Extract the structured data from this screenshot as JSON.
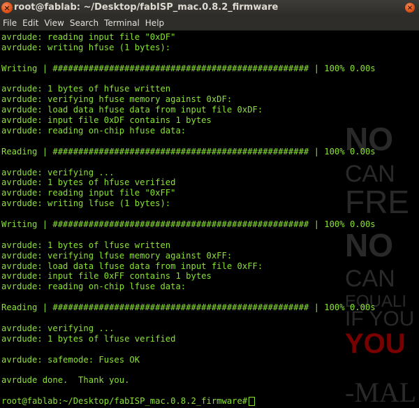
{
  "window": {
    "title": "root@fablab: ~/Desktop/fabISP_mac.0.8.2_firmware",
    "close_glyph": "×"
  },
  "menu": [
    "File",
    "Edit",
    "View",
    "Search",
    "Terminal",
    "Help"
  ],
  "terminal": {
    "text_color": "#8ae234",
    "lines": [
      "avrdude: reading input file \"0xDF\"",
      "avrdude: writing hfuse (1 bytes):",
      "",
      "Writing | ################################################## | 100% 0.00s",
      "",
      "avrdude: 1 bytes of hfuse written",
      "avrdude: verifying hfuse memory against 0xDF:",
      "avrdude: load data hfuse data from input file 0xDF:",
      "avrdude: input file 0xDF contains 1 bytes",
      "avrdude: reading on-chip hfuse data:",
      "",
      "Reading | ################################################## | 100% 0.00s",
      "",
      "avrdude: verifying ...",
      "avrdude: 1 bytes of hfuse verified",
      "avrdude: reading input file \"0xFF\"",
      "avrdude: writing lfuse (1 bytes):",
      "",
      "Writing | ################################################## | 100% 0.00s",
      "",
      "avrdude: 1 bytes of lfuse written",
      "avrdude: verifying lfuse memory against 0xFF:",
      "avrdude: load data lfuse data from input file 0xFF:",
      "avrdude: input file 0xFF contains 1 bytes",
      "avrdude: reading on-chip lfuse data:",
      "",
      "Reading | ################################################## | 100% 0.00s",
      "",
      "avrdude: verifying ...",
      "avrdude: 1 bytes of lfuse verified",
      "",
      "avrdude: safemode: Fuses OK",
      "",
      "avrdude done.  Thank you.",
      ""
    ],
    "prompt": "root@fablab:~/Desktop/fabISP_mac.0.8.2_firmware#"
  },
  "wallpaper": {
    "words": [
      "NO",
      "CAN",
      "FRE",
      "NO",
      "CAN",
      "EQUALI",
      "IF YOU",
      "YOU",
      "-MAL"
    ],
    "highlight_color": "#8b0000"
  }
}
